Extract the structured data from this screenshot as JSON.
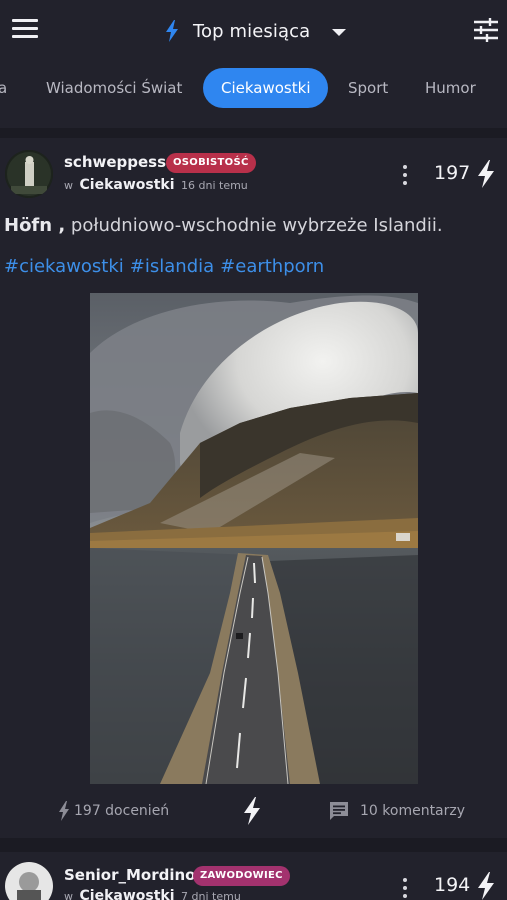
{
  "header": {
    "title": "Top miesiąca",
    "menu_icon": "hamburger-menu-icon",
    "filter_icon": "sliders-icon",
    "accent": "#2f86f0"
  },
  "tabs": [
    {
      "label": "a"
    },
    {
      "label": "Wiadomości Świat"
    },
    {
      "label": "Ciekawostki",
      "active": true
    },
    {
      "label": "Sport"
    },
    {
      "label": "Humor"
    }
  ],
  "posts": [
    {
      "author": "schweppess",
      "badge": "OSOBISTOŚĆ",
      "badge_color": "#b8304a",
      "in_prefix": "w",
      "community": "Ciekawostki",
      "time": "16 dni temu",
      "score": "197",
      "title_bold": "Höfn ,",
      "title_rest": " południowo-wschodnie wybrzeże Islandii.",
      "tags": [
        "#ciekawostki",
        "#islandia",
        "#earthporn"
      ],
      "upvotes_label": "197 docenień",
      "comments_label": "10 komentarzy"
    },
    {
      "author": "Senior_Mordino",
      "badge": "ZAWODOWIEC",
      "badge_color": "#a3326e",
      "in_prefix": "w",
      "community": "Ciekawostki",
      "time": "7 dni temu",
      "score": "194"
    }
  ]
}
